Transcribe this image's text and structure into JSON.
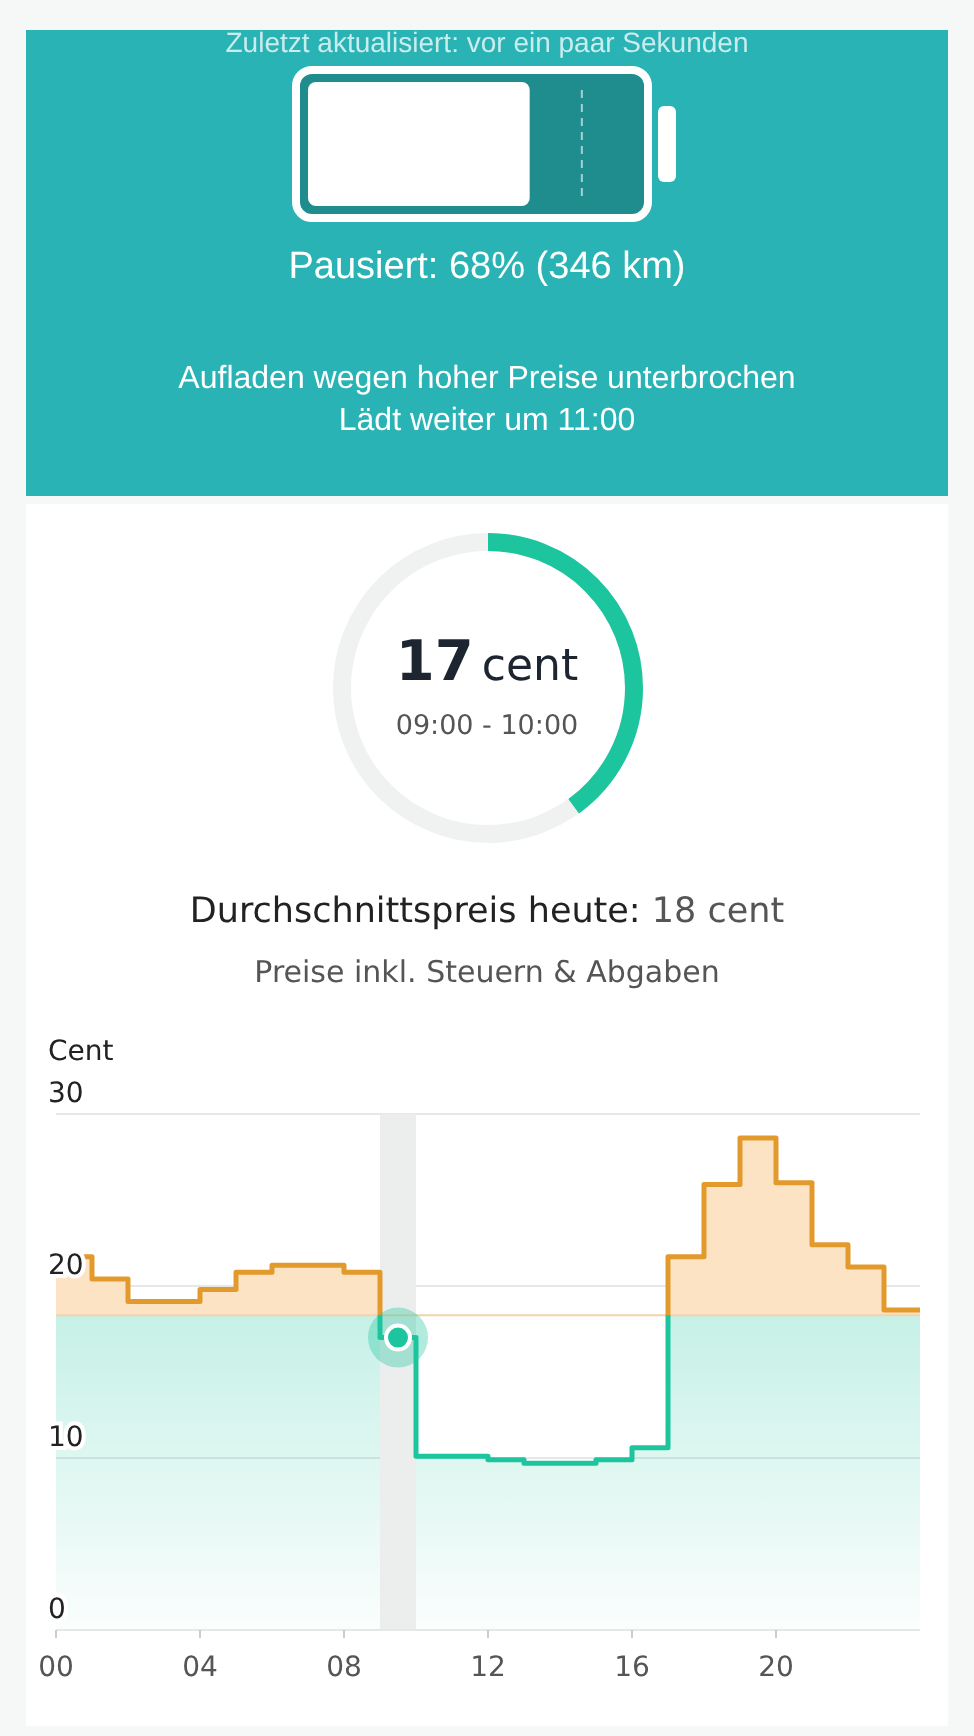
{
  "battery_card": {
    "updated": "Zuletzt aktualisiert: vor ein paar Sekunden",
    "battery": {
      "level": 0.68
    },
    "status": "Pausiert: 68% (346 km)",
    "message": "Aufladen wegen hoher Preise unterbrochen",
    "resume": "Lädt weiter um 11:00"
  },
  "current_price": {
    "value": "17",
    "unit": "cent",
    "time_range": "09:00 - 10:00"
  },
  "average": {
    "label": "Durchschnittspreis heute:",
    "value": "18 cent"
  },
  "note": "Preise inkl. Steuern & Abgaben",
  "price_chart": {
    "chart_data": {
      "type": "area",
      "ylabel": "Cent",
      "x": [
        0,
        1,
        1,
        2,
        2,
        3,
        3,
        4,
        4,
        5,
        5,
        6,
        6,
        7,
        7,
        8,
        8,
        9,
        9,
        10,
        10,
        11,
        11,
        12,
        12,
        13,
        13,
        14,
        14,
        15,
        15,
        16,
        16,
        17,
        17,
        18,
        18,
        19,
        19,
        20,
        20,
        21,
        21,
        22,
        22,
        23,
        23,
        24
      ],
      "series": [
        {
          "color": "#e39a2d",
          "values": [
            21.7,
            21.7,
            20.4,
            20.4,
            19.1,
            19.1,
            19.1,
            19.1,
            19.8,
            19.8,
            20.8,
            20.8,
            21.2,
            21.2,
            21.2,
            21.2,
            20.8,
            20.8,
            17.0,
            17.0,
            10.1,
            10.1,
            10.1,
            10.1,
            9.9,
            9.9,
            9.7,
            9.7,
            9.7,
            9.7,
            9.9,
            9.9,
            10.6,
            10.6,
            21.7,
            21.7,
            25.9,
            25.9,
            28.6,
            28.6,
            26.0,
            26.0,
            22.4,
            22.4,
            21.1,
            21.1,
            18.6,
            18.6
          ]
        }
      ],
      "xlim": [
        0,
        24
      ],
      "ylim": [
        0,
        30
      ],
      "xticks": [
        {
          "value": 0,
          "label": "00"
        },
        {
          "value": 4,
          "label": "04"
        },
        {
          "value": 8,
          "label": "08"
        },
        {
          "value": 12,
          "label": "12"
        },
        {
          "value": 16,
          "label": "16"
        },
        {
          "value": 20,
          "label": "20"
        }
      ],
      "yticks": [
        0,
        10,
        20,
        30
      ],
      "ref_lines": [
        {
          "axis": "y",
          "value": 18.3
        }
      ],
      "bands": [
        {
          "axis": "x",
          "from": 9,
          "to": 10
        }
      ]
    }
  }
}
